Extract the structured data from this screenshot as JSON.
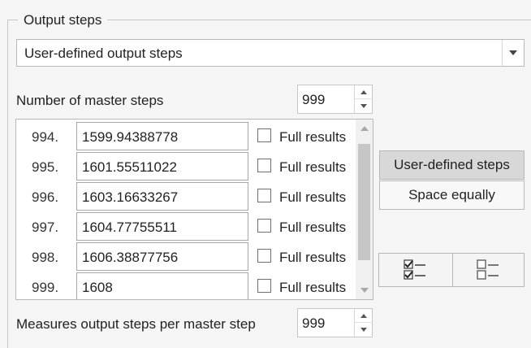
{
  "group": {
    "title": "Output steps"
  },
  "output_mode": {
    "selected": "User-defined output steps"
  },
  "master_steps": {
    "label": "Number of master steps",
    "value": "999"
  },
  "steps": [
    {
      "index": "994.",
      "value": "1599.94388778",
      "full_results_label": "Full results",
      "checked": false
    },
    {
      "index": "995.",
      "value": "1601.55511022",
      "full_results_label": "Full results",
      "checked": false
    },
    {
      "index": "996.",
      "value": "1603.16633267",
      "full_results_label": "Full results",
      "checked": false
    },
    {
      "index": "997.",
      "value": "1604.77755511",
      "full_results_label": "Full results",
      "checked": false
    },
    {
      "index": "998.",
      "value": "1606.38877756",
      "full_results_label": "Full results",
      "checked": false
    },
    {
      "index": "999.",
      "value": "1608",
      "full_results_label": "Full results",
      "checked": false
    }
  ],
  "buttons": {
    "user_defined": "User-defined steps",
    "space_equally": "Space equally",
    "check_all_icon": "check-all-icon",
    "uncheck_all_icon": "uncheck-all-icon"
  },
  "measures": {
    "label": "Measures output steps per master step",
    "value": "999"
  },
  "colors": {
    "active_button": "#d8d8d8",
    "background": "#f5f5f5",
    "border": "#b8b8b8"
  }
}
